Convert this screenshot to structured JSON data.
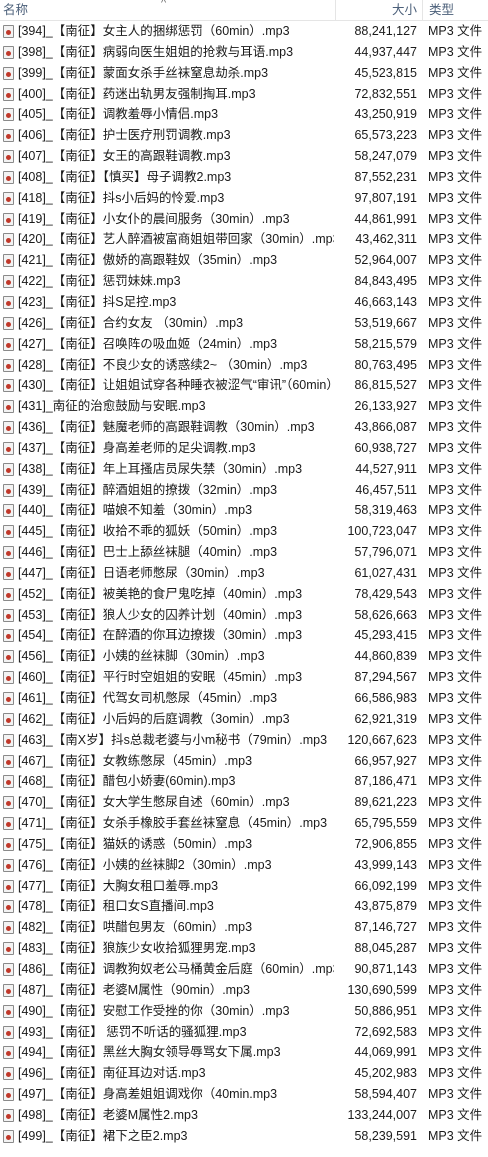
{
  "columns": {
    "name": "名称",
    "size": "大小",
    "type": "类型",
    "sort_indicator": "^"
  },
  "files": [
    {
      "name": "[394]_【南征】女主人的捆绑惩罚（60min）.mp3",
      "size": "88,241,127",
      "type": "MP3 文件"
    },
    {
      "name": "[398]_【南征】病弱向医生姐姐的抢救与耳语.mp3",
      "size": "44,937,447",
      "type": "MP3 文件"
    },
    {
      "name": "[399]_【南征】蒙面女杀手丝袜窒息劫杀.mp3",
      "size": "45,523,815",
      "type": "MP3 文件"
    },
    {
      "name": "[400]_【南征】药迷出轨男友强制掏耳.mp3",
      "size": "72,832,551",
      "type": "MP3 文件"
    },
    {
      "name": "[405]_【南征】调教羞辱小情侣.mp3",
      "size": "43,250,919",
      "type": "MP3 文件"
    },
    {
      "name": "[406]_【南征】护士医疗刑罚调教.mp3",
      "size": "65,573,223",
      "type": "MP3 文件"
    },
    {
      "name": "[407]_【南征】女王的高跟鞋调教.mp3",
      "size": "58,247,079",
      "type": "MP3 文件"
    },
    {
      "name": "[408]_【南征】【慎买】母子调教2.mp3",
      "size": "87,552,231",
      "type": "MP3 文件"
    },
    {
      "name": "[418]_【南征】抖s小后妈的怜爱.mp3",
      "size": "97,807,191",
      "type": "MP3 文件"
    },
    {
      "name": "[419]_【南征】小女仆的晨间服务（30min）.mp3",
      "size": "44,861,991",
      "type": "MP3 文件"
    },
    {
      "name": "[420]_【南征】艺人醉酒被富商姐姐带回家（30min）.mp3",
      "size": "43,462,311",
      "type": "MP3 文件"
    },
    {
      "name": "[421]_【南征】傲娇的高跟鞋奴（35min）.mp3",
      "size": "52,964,007",
      "type": "MP3 文件"
    },
    {
      "name": "[422]_【南征】惩罚妹妹.mp3",
      "size": "84,843,495",
      "type": "MP3 文件"
    },
    {
      "name": "[423]_【南征】抖S足控.mp3",
      "size": "46,663,143",
      "type": "MP3 文件"
    },
    {
      "name": "[426]_【南征】合约女友 （30min）.mp3",
      "size": "53,519,667",
      "type": "MP3 文件"
    },
    {
      "name": "[427]_【南征】召唤阵の吸血姬（24min）.mp3",
      "size": "58,215,579",
      "type": "MP3 文件"
    },
    {
      "name": "[428]_【南征】不良少女的诱惑续2~ （30min）.mp3",
      "size": "80,763,495",
      "type": "MP3 文件"
    },
    {
      "name": "[430]_【南征】让姐姐试穿各种睡衣被涩气“审讯”（60min）.mp3",
      "size": "86,815,527",
      "type": "MP3 文件"
    },
    {
      "name": "[431]_南征的治愈鼓励与安眠.mp3",
      "size": "26,133,927",
      "type": "MP3 文件"
    },
    {
      "name": "[436]_【南征】魅魔老师的高跟鞋调教（30min）.mp3",
      "size": "43,866,087",
      "type": "MP3 文件"
    },
    {
      "name": "[437]_【南征】身高差老师的足尖调教.mp3",
      "size": "60,938,727",
      "type": "MP3 文件"
    },
    {
      "name": "[438]_【南征】年上耳搔店员尿失禁（30min）.mp3",
      "size": "44,527,911",
      "type": "MP3 文件"
    },
    {
      "name": "[439]_【南征】醉酒姐姐的撩拨（32min）.mp3",
      "size": "46,457,511",
      "type": "MP3 文件"
    },
    {
      "name": "[440]_【南征】喵娘不知羞（30min）.mp3",
      "size": "58,319,463",
      "type": "MP3 文件"
    },
    {
      "name": "[445]_【南征】收拾不乖的狐妖（50min）.mp3",
      "size": "100,723,047",
      "type": "MP3 文件"
    },
    {
      "name": "[446]_【南征】巴士上舔丝袜腿（40min）.mp3",
      "size": "57,796,071",
      "type": "MP3 文件"
    },
    {
      "name": "[447]_【南征】日语老师憋尿（30min）.mp3",
      "size": "61,027,431",
      "type": "MP3 文件"
    },
    {
      "name": "[452]_【南征】被美艳的食尸鬼吃掉（40min）.mp3",
      "size": "78,429,543",
      "type": "MP3 文件"
    },
    {
      "name": "[453]_【南征】狼人少女的囚养计划（40min）.mp3",
      "size": "58,626,663",
      "type": "MP3 文件"
    },
    {
      "name": "[454]_【南征】在醉酒的你耳边撩拨（30min）.mp3",
      "size": "45,293,415",
      "type": "MP3 文件"
    },
    {
      "name": "[456]_【南征】小姨的丝袜脚（30min）.mp3",
      "size": "44,860,839",
      "type": "MP3 文件"
    },
    {
      "name": "[460]_【南征】平行时空姐姐的安眠（45min）.mp3",
      "size": "87,294,567",
      "type": "MP3 文件"
    },
    {
      "name": "[461]_【南征】代驾女司机憋尿（45min）.mp3",
      "size": "66,586,983",
      "type": "MP3 文件"
    },
    {
      "name": "[462]_【南征】小后妈的后庭调教（3omin）.mp3",
      "size": "62,921,319",
      "type": "MP3 文件"
    },
    {
      "name": "[463]_【南X岁】抖s总裁老婆与小m秘书（79min）.mp3",
      "size": "120,667,623",
      "type": "MP3 文件"
    },
    {
      "name": "[467]_【南征】女教练憋尿（45min）.mp3",
      "size": "66,957,927",
      "type": "MP3 文件"
    },
    {
      "name": "[468]_【南征】醋包小娇妻(60min).mp3",
      "size": "87,186,471",
      "type": "MP3 文件"
    },
    {
      "name": "[470]_【南征】女大学生憋尿自述（60min）.mp3",
      "size": "89,621,223",
      "type": "MP3 文件"
    },
    {
      "name": "[471]_【南征】女杀手橡胶手套丝袜窒息（45min）.mp3",
      "size": "65,795,559",
      "type": "MP3 文件"
    },
    {
      "name": "[475]_【南征】猫妖的诱惑（50min）.mp3",
      "size": "72,906,855",
      "type": "MP3 文件"
    },
    {
      "name": "[476]_【南征】小姨的丝袜脚2（30min）.mp3",
      "size": "43,999,143",
      "type": "MP3 文件"
    },
    {
      "name": "[477]_【南征】大胸女租口羞辱.mp3",
      "size": "66,092,199",
      "type": "MP3 文件"
    },
    {
      "name": "[478]_【南征】租口女S直播间.mp3",
      "size": "43,875,879",
      "type": "MP3 文件"
    },
    {
      "name": "[482]_【南征】哄醋包男友（60min）.mp3",
      "size": "87,146,727",
      "type": "MP3 文件"
    },
    {
      "name": "[483]_【南征】狼族少女收拾狐狸男宠.mp3",
      "size": "88,045,287",
      "type": "MP3 文件"
    },
    {
      "name": "[486]_【南征】调教狗奴老公马桶黄金后庭（60min）.mp3",
      "size": "90,871,143",
      "type": "MP3 文件"
    },
    {
      "name": "[487]_【南征】老婆M属性（90min）.mp3",
      "size": "130,690,599",
      "type": "MP3 文件"
    },
    {
      "name": "[490]_【南征】安慰工作受挫的你（30min）.mp3",
      "size": "50,886,951",
      "type": "MP3 文件"
    },
    {
      "name": "[493]_【南征】 惩罚不听话的骚狐狸.mp3",
      "size": "72,692,583",
      "type": "MP3 文件"
    },
    {
      "name": "[494]_【南征】黑丝大胸女领导辱骂女下属.mp3",
      "size": "44,069,991",
      "type": "MP3 文件"
    },
    {
      "name": "[496]_【南征】南征耳边对话.mp3",
      "size": "45,202,983",
      "type": "MP3 文件"
    },
    {
      "name": "[497]_【南征】身高差姐姐调戏你（40min.mp3",
      "size": "58,594,407",
      "type": "MP3 文件"
    },
    {
      "name": "[498]_【南征】老婆M属性2.mp3",
      "size": "133,244,007",
      "type": "MP3 文件"
    },
    {
      "name": "[499]_【南征】裙下之臣2.mp3",
      "size": "58,239,591",
      "type": "MP3 文件"
    }
  ]
}
